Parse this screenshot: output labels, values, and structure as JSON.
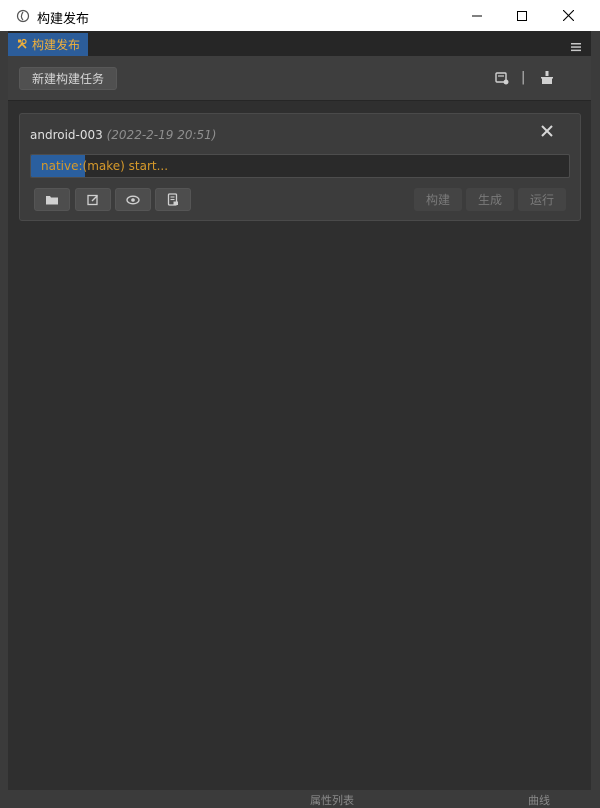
{
  "window": {
    "title": "构建发布",
    "icon": "cocos-icon"
  },
  "tab": {
    "label": "构建发布",
    "icon": "tools-icon"
  },
  "toolbar": {
    "new_task_label": "新建构建任务",
    "separator": "|"
  },
  "task": {
    "name": "android-003",
    "time": "(2022-2-19 20:51)",
    "progress_text": "native:(make) start...",
    "progress_fraction": 0.1,
    "build_label": "构建",
    "make_label": "生成",
    "run_label": "运行"
  },
  "background_fragments": {
    "left_text": "属性列表",
    "right_text": "曲线"
  },
  "colors": {
    "accent_tab": "#2c5d9a",
    "tab_text": "#f0b03a",
    "progress_fill": "#2a5f9f",
    "progress_text": "#d79a2a"
  }
}
